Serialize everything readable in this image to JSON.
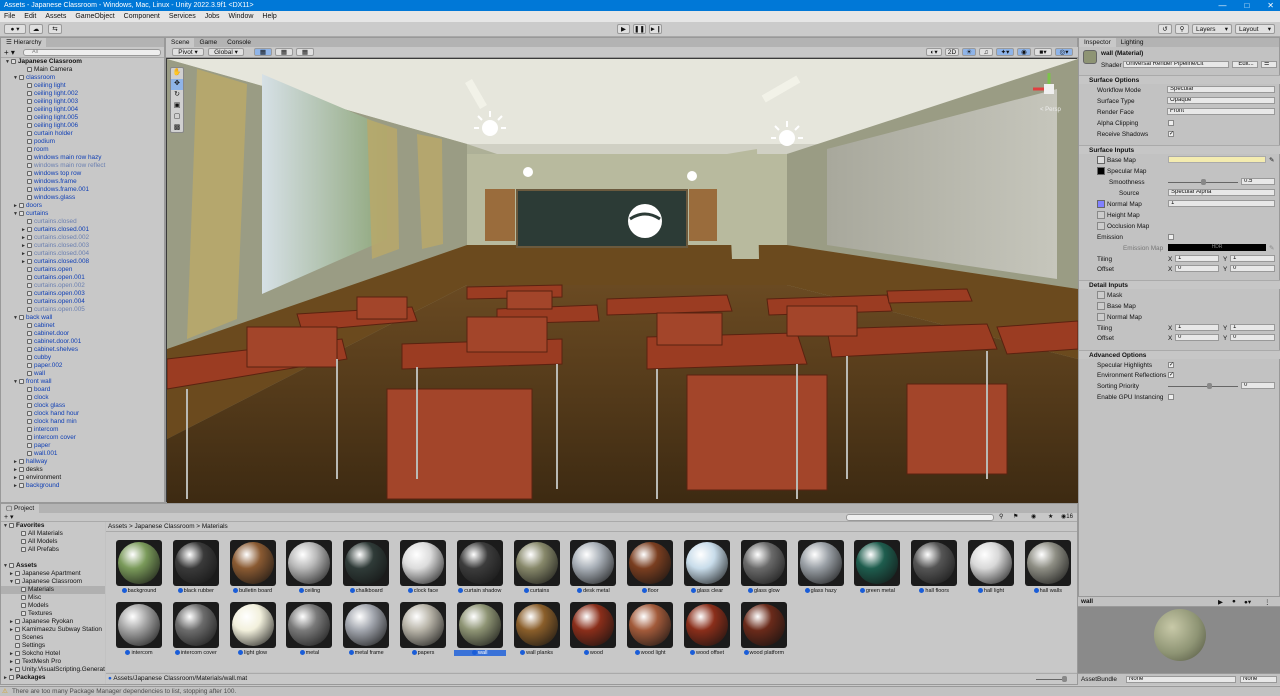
{
  "window": {
    "title": "Assets - Japanese Classroom - Windows, Mac, Linux - Unity 2022.3.9f1 <DX11>"
  },
  "menu": [
    "File",
    "Edit",
    "Assets",
    "GameObject",
    "Component",
    "Services",
    "Jobs",
    "Window",
    "Help"
  ],
  "toolbar": {
    "layers": "Layers",
    "layout": "Layout"
  },
  "hierarchy": {
    "tab": "Hierarchy",
    "search_placeholder": "All",
    "rows": [
      {
        "t": "Japanese Classroom",
        "d": 0,
        "s": "bold",
        "a": "▼"
      },
      {
        "t": "Main Camera",
        "d": 2,
        "s": ""
      },
      {
        "t": "classroom",
        "d": 1,
        "s": "blue",
        "a": "▼"
      },
      {
        "t": "ceiling light",
        "d": 2,
        "s": "blue"
      },
      {
        "t": "ceiling light.002",
        "d": 2,
        "s": "blue"
      },
      {
        "t": "ceiling light.003",
        "d": 2,
        "s": "blue"
      },
      {
        "t": "ceiling light.004",
        "d": 2,
        "s": "blue"
      },
      {
        "t": "ceiling light.005",
        "d": 2,
        "s": "blue"
      },
      {
        "t": "ceiling light.006",
        "d": 2,
        "s": "blue"
      },
      {
        "t": "curtain holder",
        "d": 2,
        "s": "blue"
      },
      {
        "t": "podium",
        "d": 2,
        "s": "blue"
      },
      {
        "t": "room",
        "d": 2,
        "s": "blue"
      },
      {
        "t": "windows main row hazy",
        "d": 2,
        "s": "blue"
      },
      {
        "t": "windows main row reflect",
        "d": 2,
        "s": "dim"
      },
      {
        "t": "windows top row",
        "d": 2,
        "s": "blue"
      },
      {
        "t": "windows.frame",
        "d": 2,
        "s": "blue"
      },
      {
        "t": "windows.frame.001",
        "d": 2,
        "s": "blue"
      },
      {
        "t": "windows.glass",
        "d": 2,
        "s": "blue"
      },
      {
        "t": "doors",
        "d": 1,
        "s": "blue",
        "a": "►"
      },
      {
        "t": "curtains",
        "d": 1,
        "s": "blue",
        "a": "▼"
      },
      {
        "t": "curtains.closed",
        "d": 2,
        "s": "dim"
      },
      {
        "t": "curtains.closed.001",
        "d": 2,
        "s": "blue",
        "a": "►"
      },
      {
        "t": "curtains.closed.002",
        "d": 2,
        "s": "dim",
        "a": "►"
      },
      {
        "t": "curtains.closed.003",
        "d": 2,
        "s": "dim",
        "a": "►"
      },
      {
        "t": "curtains.closed.004",
        "d": 2,
        "s": "dim",
        "a": "►"
      },
      {
        "t": "curtains.closed.008",
        "d": 2,
        "s": "blue",
        "a": "►"
      },
      {
        "t": "curtains.open",
        "d": 2,
        "s": "blue"
      },
      {
        "t": "curtains.open.001",
        "d": 2,
        "s": "blue"
      },
      {
        "t": "curtains.open.002",
        "d": 2,
        "s": "dim"
      },
      {
        "t": "curtains.open.003",
        "d": 2,
        "s": "blue"
      },
      {
        "t": "curtains.open.004",
        "d": 2,
        "s": "blue"
      },
      {
        "t": "curtains.open.005",
        "d": 2,
        "s": "dim"
      },
      {
        "t": "back wall",
        "d": 1,
        "s": "blue",
        "a": "▼"
      },
      {
        "t": "cabinet",
        "d": 2,
        "s": "blue"
      },
      {
        "t": "cabinet.door",
        "d": 2,
        "s": "blue"
      },
      {
        "t": "cabinet.door.001",
        "d": 2,
        "s": "blue"
      },
      {
        "t": "cabinet.shelves",
        "d": 2,
        "s": "blue"
      },
      {
        "t": "cubby",
        "d": 2,
        "s": "blue"
      },
      {
        "t": "paper.002",
        "d": 2,
        "s": "blue"
      },
      {
        "t": "wall",
        "d": 2,
        "s": "blue"
      },
      {
        "t": "front wall",
        "d": 1,
        "s": "blue",
        "a": "▼"
      },
      {
        "t": "board",
        "d": 2,
        "s": "blue"
      },
      {
        "t": "clock",
        "d": 2,
        "s": "blue"
      },
      {
        "t": "clock glass",
        "d": 2,
        "s": "blue"
      },
      {
        "t": "clock hand hour",
        "d": 2,
        "s": "blue"
      },
      {
        "t": "clock hand min",
        "d": 2,
        "s": "blue"
      },
      {
        "t": "intercom",
        "d": 2,
        "s": "blue"
      },
      {
        "t": "intercom cover",
        "d": 2,
        "s": "blue"
      },
      {
        "t": "paper",
        "d": 2,
        "s": "blue"
      },
      {
        "t": "wall.001",
        "d": 2,
        "s": "blue"
      },
      {
        "t": "hallway",
        "d": 1,
        "s": "blue",
        "a": "►"
      },
      {
        "t": "desks",
        "d": 1,
        "s": "",
        "a": "►"
      },
      {
        "t": "environment",
        "d": 1,
        "s": "",
        "a": "►"
      },
      {
        "t": "background",
        "d": 1,
        "s": "blue",
        "a": "►"
      }
    ]
  },
  "scene": {
    "tabs": [
      "Scene",
      "Game",
      "Console"
    ],
    "pivot": "Pivot",
    "global": "Global",
    "mode_2d": "2D",
    "persp": "< Persp"
  },
  "inspector": {
    "tabs": [
      "Inspector",
      "Lighting"
    ],
    "name": "wall (Material)",
    "shader_label": "Shader",
    "shader": "Universal Render Pipeline/Lit",
    "edit": "Edit...",
    "surface_options": "Surface Options",
    "workflow_label": "Workflow Mode",
    "workflow": "Specular",
    "surface_type_label": "Surface Type",
    "surface_type": "Opaque",
    "render_face_label": "Render Face",
    "render_face": "Front",
    "alpha_clip": "Alpha Clipping",
    "receive_shadows": "Receive Shadows",
    "surface_inputs": "Surface Inputs",
    "base_map": "Base Map",
    "specular_map": "Specular Map",
    "smoothness": "Smoothness",
    "smoothness_val": "0.5",
    "smoothness_frac": 0.5,
    "source": "Source",
    "source_val": "Specular Alpha",
    "normal_map": "Normal Map",
    "normal_val": "1",
    "height_map": "Height Map",
    "occlusion_map": "Occlusion Map",
    "emission": "Emission",
    "emission_map": "Emission Map",
    "hdr": "HDR",
    "tiling": "Tiling",
    "offset": "Offset",
    "x": "X",
    "y": "Y",
    "tiling_x": "1",
    "tiling_y": "1",
    "offset_x": "0",
    "offset_y": "0",
    "detail_inputs": "Detail Inputs",
    "mask": "Mask",
    "d_base_map": "Base Map",
    "d_normal_map": "Normal Map",
    "d_tiling_x": "1",
    "d_tiling_y": "1",
    "d_offset_x": "0",
    "d_offset_y": "0",
    "advanced": "Advanced Options",
    "spec_high": "Specular Highlights",
    "env_refl": "Environment Reflections",
    "sort_pri": "Sorting Priority",
    "sort_val": "0",
    "gpu_inst": "Enable GPU Instancing",
    "check": "✓",
    "preview_name": "wall",
    "assetbundle": "AssetBundle",
    "ab_none1": "None",
    "ab_none2": "None"
  },
  "project": {
    "tab": "Project",
    "breadcrumb": [
      "Assets",
      "Japanese Classroom",
      "Materials"
    ],
    "count": "16",
    "tree": [
      {
        "t": "Favorites",
        "d": 0,
        "bold": true,
        "a": "▼"
      },
      {
        "t": "All Materials",
        "d": 2
      },
      {
        "t": "All Models",
        "d": 2
      },
      {
        "t": "All Prefabs",
        "d": 2
      },
      {
        "t": "",
        "d": 0
      },
      {
        "t": "Assets",
        "d": 0,
        "bold": true,
        "a": "▼"
      },
      {
        "t": "Japanese Apartment",
        "d": 1,
        "a": "►"
      },
      {
        "t": "Japanese Classroom",
        "d": 1,
        "a": "▼"
      },
      {
        "t": "Materials",
        "d": 2,
        "sel": true
      },
      {
        "t": "Misc",
        "d": 2
      },
      {
        "t": "Models",
        "d": 2
      },
      {
        "t": "Textures",
        "d": 2
      },
      {
        "t": "Japanese Ryokan",
        "d": 1,
        "a": "►"
      },
      {
        "t": "Kamimaezu Subway Station",
        "d": 1,
        "a": "►"
      },
      {
        "t": "Scenes",
        "d": 1
      },
      {
        "t": "Settings",
        "d": 1
      },
      {
        "t": "Sokcho Hotel",
        "d": 1,
        "a": "►"
      },
      {
        "t": "TextMesh Pro",
        "d": 1,
        "a": "►"
      },
      {
        "t": "Unity.VisualScripting.Generated",
        "d": 1,
        "a": "►"
      },
      {
        "t": "Packages",
        "d": 0,
        "bold": true,
        "a": "►"
      }
    ],
    "assets": [
      {
        "n": "background",
        "c": "#7a9a5a"
      },
      {
        "n": "black rubber",
        "c": "#3a3a3a"
      },
      {
        "n": "bulletin board",
        "c": "#8a5a32"
      },
      {
        "n": "ceiling",
        "c": "#b8b8b8"
      },
      {
        "n": "chalkboard",
        "c": "#2f3b38"
      },
      {
        "n": "clock face",
        "c": "#dcdcdc"
      },
      {
        "n": "curtain shadow",
        "c": "#3c3c3c"
      },
      {
        "n": "curtains",
        "c": "#87886a"
      },
      {
        "n": "desk metal",
        "c": "#a9b0b8"
      },
      {
        "n": "floor",
        "c": "#7a3e20"
      },
      {
        "n": "glass clear",
        "c": "#c8dcea"
      },
      {
        "n": "glass glow",
        "c": "#6a6a6a"
      },
      {
        "n": "glass hazy",
        "c": "#9aa0a6"
      },
      {
        "n": "green metal",
        "c": "#1e5d4e"
      },
      {
        "n": "hall floors",
        "c": "#555555"
      },
      {
        "n": "hall light",
        "c": "#d8d8d8"
      },
      {
        "n": "hall walls",
        "c": "#8e8e84"
      },
      {
        "n": "intercom",
        "c": "#a6a6a6"
      },
      {
        "n": "intercom cover",
        "c": "#6c6c6c"
      },
      {
        "n": "light glow",
        "c": "#f2f0dc"
      },
      {
        "n": "metal",
        "c": "#7a7a7a"
      },
      {
        "n": "metal frame",
        "c": "#a2a6ae"
      },
      {
        "n": "papers",
        "c": "#b8b4a8"
      },
      {
        "n": "wall",
        "c": "#8e9474"
      },
      {
        "n": "wall planks",
        "c": "#8a5e2a"
      },
      {
        "n": "wood",
        "c": "#8a2e1a"
      },
      {
        "n": "wood light",
        "c": "#a25a3a"
      },
      {
        "n": "wood offset",
        "c": "#8a2e1a"
      },
      {
        "n": "wood platform",
        "c": "#6a2a1a"
      }
    ],
    "path": "Assets/Japanese Classroom/Materials/wall.mat"
  },
  "status": "There are too many Package Manager dependencies to list, stopping after 100."
}
